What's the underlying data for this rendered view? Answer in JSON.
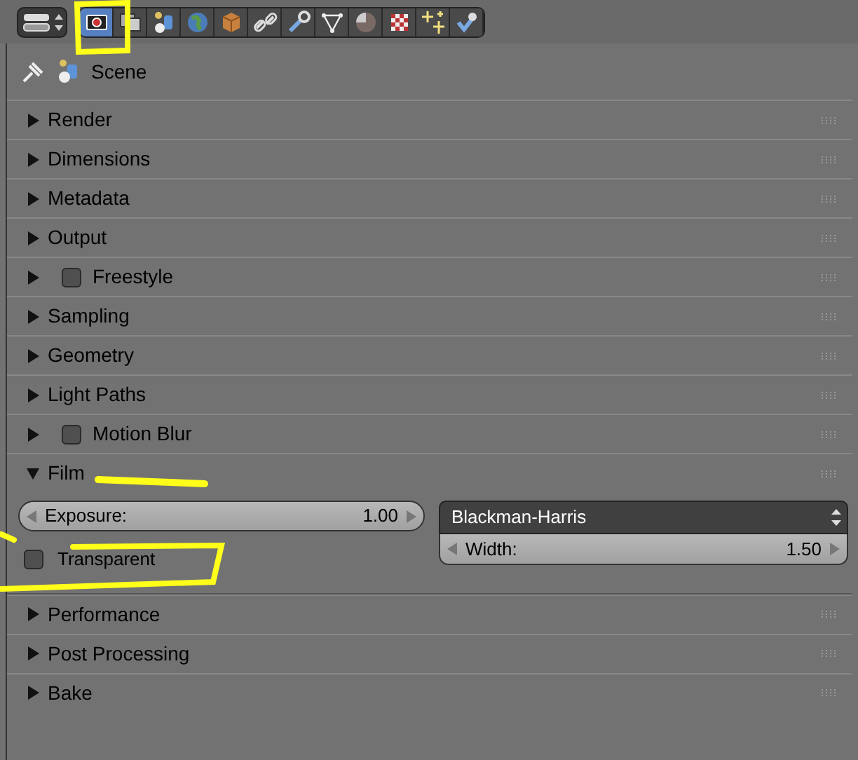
{
  "tabs": [
    {
      "kind": "camera",
      "selected": true
    },
    {
      "kind": "layers",
      "selected": false
    },
    {
      "kind": "scene",
      "selected": false
    },
    {
      "kind": "world",
      "selected": false
    },
    {
      "kind": "cube",
      "selected": false
    },
    {
      "kind": "chain",
      "selected": false
    },
    {
      "kind": "wrench",
      "selected": false
    },
    {
      "kind": "triangle",
      "selected": false
    },
    {
      "kind": "sphere",
      "selected": false
    },
    {
      "kind": "checker",
      "selected": false
    },
    {
      "kind": "sparkle",
      "selected": false
    },
    {
      "kind": "physics",
      "selected": false
    }
  ],
  "context": {
    "label": "Scene"
  },
  "panels": [
    {
      "label": "Render",
      "expanded": false
    },
    {
      "label": "Dimensions",
      "expanded": false
    },
    {
      "label": "Metadata",
      "expanded": false
    },
    {
      "label": "Output",
      "expanded": false
    },
    {
      "label": "Freestyle",
      "expanded": false,
      "checked": false
    },
    {
      "label": "Sampling",
      "expanded": false
    },
    {
      "label": "Geometry",
      "expanded": false
    },
    {
      "label": "Light Paths",
      "expanded": false
    },
    {
      "label": "Motion Blur",
      "expanded": false,
      "checked": false
    },
    {
      "label": "Film",
      "expanded": true,
      "content": {
        "exposure": {
          "label": "Exposure:",
          "value": "1.00"
        },
        "transparent": {
          "label": "Transparent",
          "checked": false
        },
        "filter": {
          "value": "Blackman-Harris"
        },
        "width": {
          "label": "Width:",
          "value": "1.50"
        }
      }
    },
    {
      "label": "Performance",
      "expanded": false
    },
    {
      "label": "Post Processing",
      "expanded": false
    },
    {
      "label": "Bake",
      "expanded": false
    }
  ]
}
